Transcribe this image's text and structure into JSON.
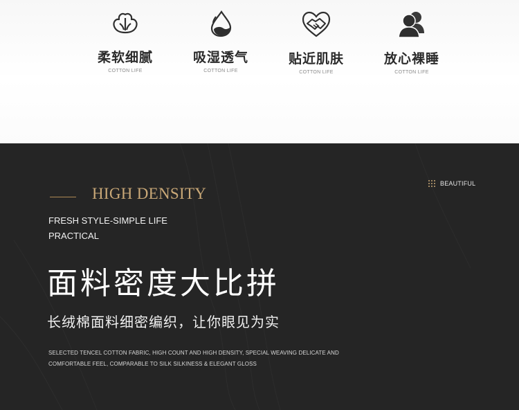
{
  "features": [
    {
      "icon": "cotton-flower-icon",
      "title": "柔软细腻",
      "subtitle": "COTTON LIFE"
    },
    {
      "icon": "water-drop-icon",
      "title": "吸湿透气",
      "subtitle": "COTTON LIFE"
    },
    {
      "icon": "heart-handshake-icon",
      "title": "贴近肌肤",
      "subtitle": "COTTON LIFE"
    },
    {
      "icon": "users-icon",
      "title": "放心裸睡",
      "subtitle": "COTTON LIFE"
    }
  ],
  "section": {
    "heading": "HIGH DENSITY",
    "badge": "BEAUTIFUL",
    "tagline_1": "FRESH STYLE-SIMPLE LIFE",
    "tagline_2": "PRACTICAL",
    "title": "面料密度大比拼",
    "subtitle": "长绒棉面料细密编织，让你眼见为实",
    "desc_1": "SELECTED TENCEL COTTON FABRIC, HIGH COUNT AND HIGH DENSITY, SPECIAL WEAVING DELICATE AND",
    "desc_2": "COMFORTABLE FEEL, COMPARABLE TO SILK SILKINESS & ELEGANT GLOSS"
  },
  "colors": {
    "accent": "#c9a877",
    "dark_bg": "#252525",
    "icon": "#2f2f2f"
  }
}
